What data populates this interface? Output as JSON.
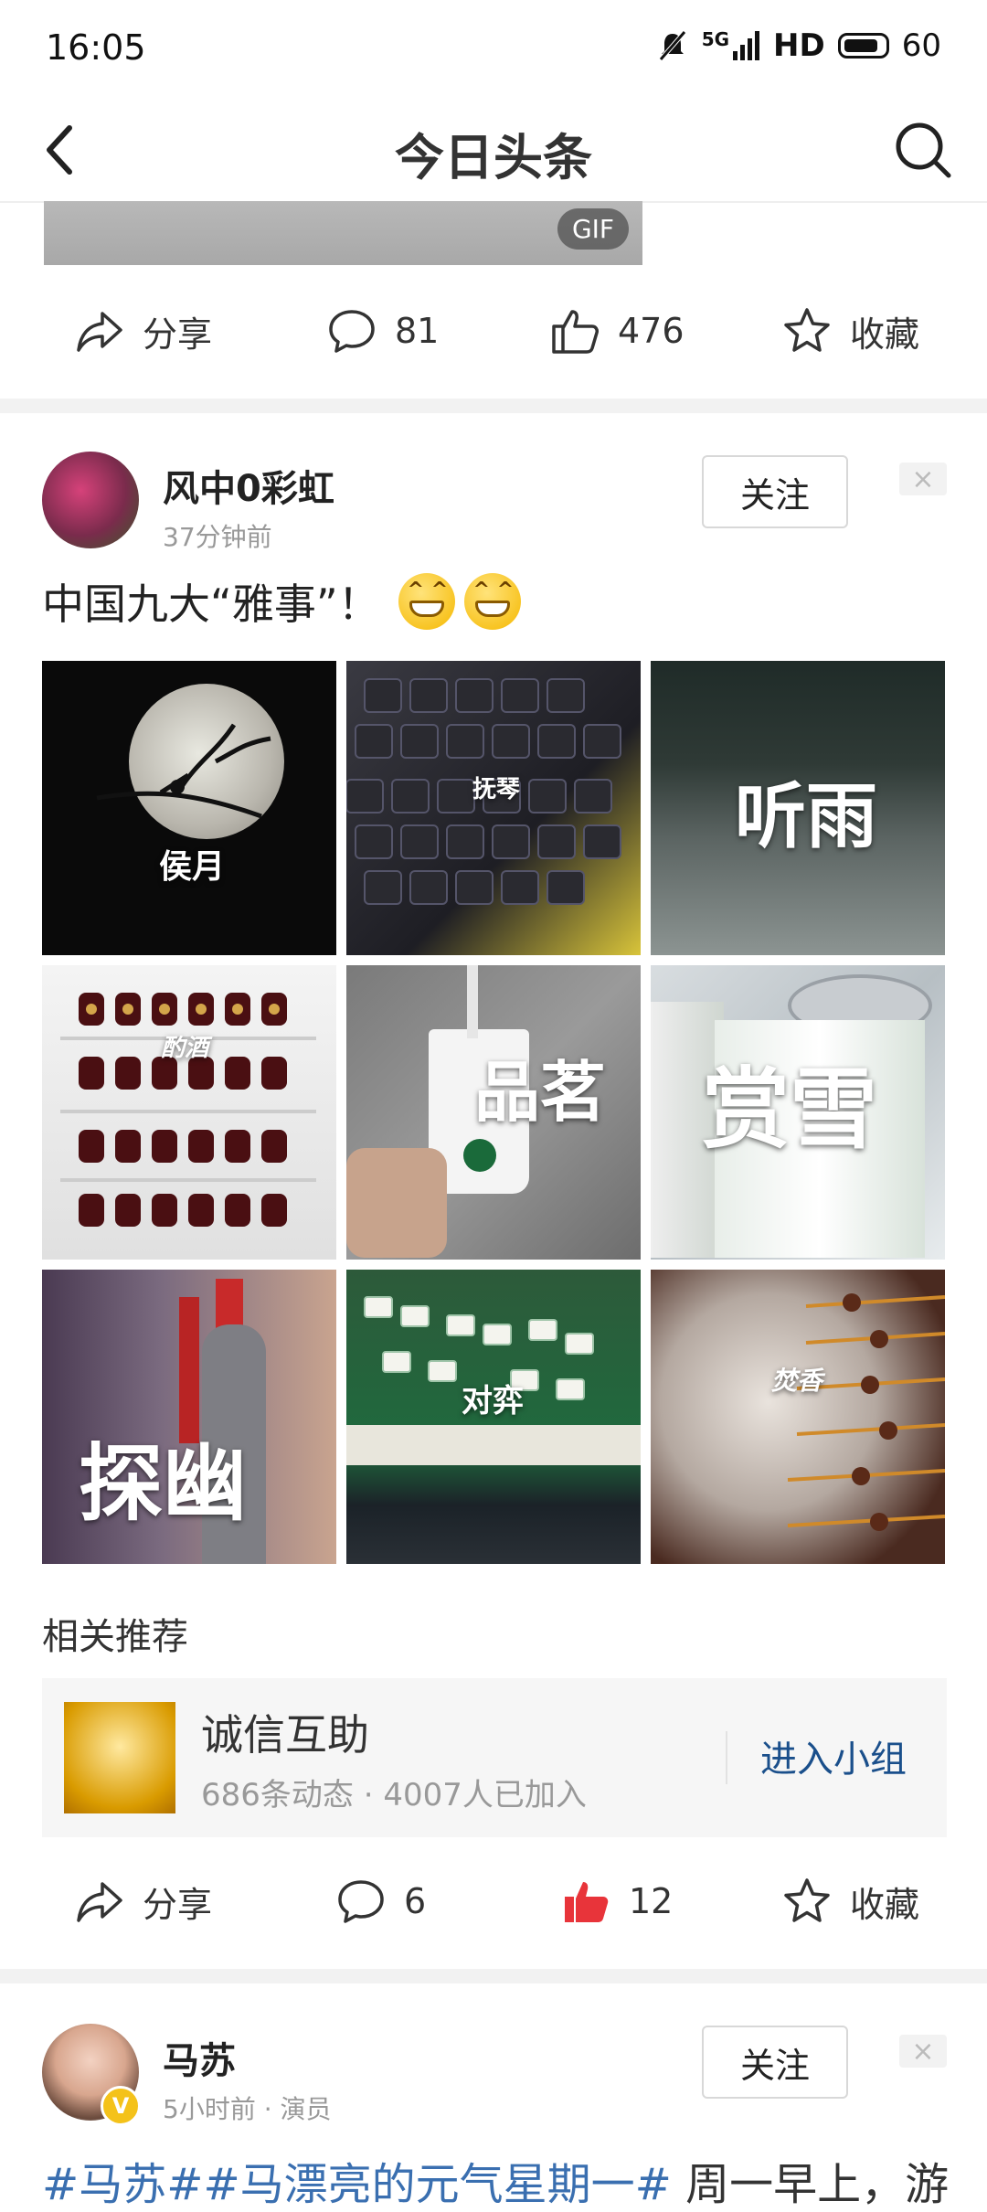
{
  "status_bar": {
    "time": "16:05",
    "network": "5G",
    "hd": "HD",
    "battery": "60"
  },
  "nav": {
    "title": "今日头条"
  },
  "top_post": {
    "gif_badge": "GIF",
    "actions": {
      "share": "分享",
      "comments": "81",
      "likes": "476",
      "favorite": "收藏"
    }
  },
  "post": {
    "author": "风中0彩虹",
    "time": "37分钟前",
    "follow": "关注",
    "close": "×",
    "text": "中国九大“雅事”！",
    "images": [
      {
        "label": "侯月"
      },
      {
        "label": "抚琴"
      },
      {
        "label": "听雨"
      },
      {
        "label": "酌酒"
      },
      {
        "label": "品茗"
      },
      {
        "label": "赏雪"
      },
      {
        "label": "探幽"
      },
      {
        "label": "对弈"
      },
      {
        "label": "焚香"
      }
    ],
    "related_title": "相关推荐",
    "related": {
      "name": "诚信互助",
      "stats": "686条动态 · 4007人已加入",
      "join": "进入小组"
    },
    "actions": {
      "share": "分享",
      "comments": "6",
      "likes": "12",
      "favorite": "收藏"
    }
  },
  "next_post": {
    "author": "马苏",
    "meta": "5小时前 · 演员",
    "follow": "关注",
    "close": "×",
    "tags": "#马苏##马漂亮的元气星期一#",
    "text": " 周一早上，游"
  },
  "colors": {
    "accent_link": "#3a6fb0",
    "like_active": "#e8343a",
    "join_blue": "#1a4f8b"
  }
}
